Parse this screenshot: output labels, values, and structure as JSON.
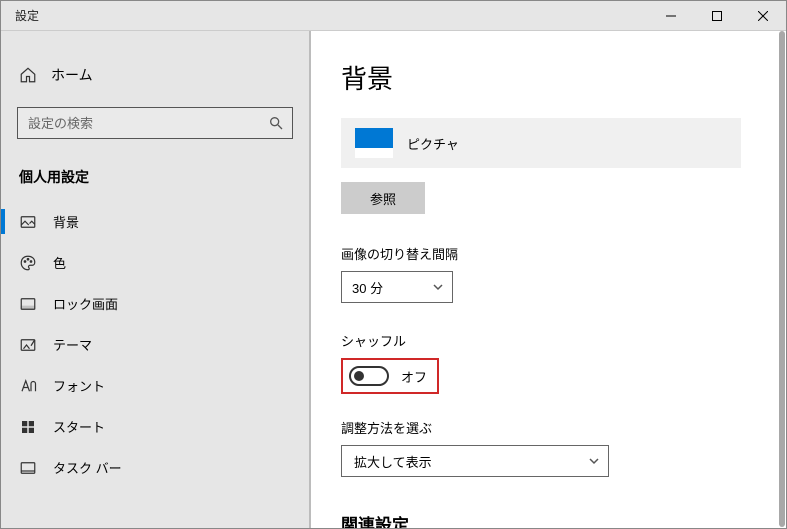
{
  "window": {
    "title": "設定"
  },
  "sidebar": {
    "home": "ホーム",
    "search_placeholder": "設定の検索",
    "section": "個人用設定",
    "items": [
      {
        "label": "背景"
      },
      {
        "label": "色"
      },
      {
        "label": "ロック画面"
      },
      {
        "label": "テーマ"
      },
      {
        "label": "フォント"
      },
      {
        "label": "スタート"
      },
      {
        "label": "タスク バー"
      }
    ]
  },
  "content": {
    "title": "背景",
    "picture_label": "ピクチャ",
    "browse": "参照",
    "interval_label": "画像の切り替え間隔",
    "interval_value": "30 分",
    "shuffle_label": "シャッフル",
    "shuffle_value": "オフ",
    "fit_label": "調整方法を選ぶ",
    "fit_value": "拡大して表示",
    "related_heading": "関連設定"
  }
}
